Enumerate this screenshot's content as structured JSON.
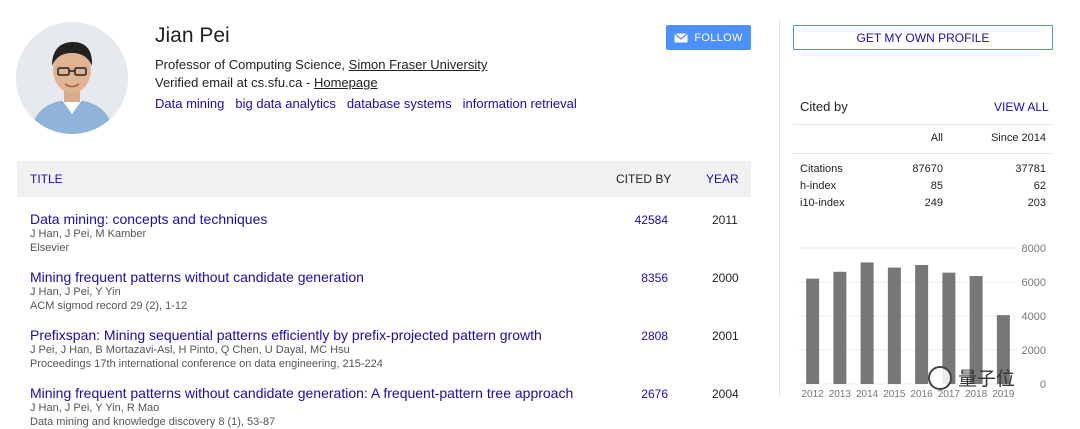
{
  "profile": {
    "name": "Jian Pei",
    "affiliation_prefix": "Professor of Computing Science, ",
    "affiliation_link": "Simon Fraser University",
    "email_text": "Verified email at cs.sfu.ca - ",
    "homepage_link": "Homepage",
    "interests": [
      "Data mining",
      "big data analytics",
      "database systems",
      "information retrieval"
    ],
    "follow_label": "FOLLOW"
  },
  "table": {
    "headers": {
      "title": "TITLE",
      "cited_by": "CITED BY",
      "year": "YEAR"
    },
    "rows": [
      {
        "title": "Data mining: concepts and techniques",
        "authors": "J Han, J Pei, M Kamber",
        "venue": "Elsevier",
        "cited_by": "42584",
        "year": "2011"
      },
      {
        "title": "Mining frequent patterns without candidate generation",
        "authors": "J Han, J Pei, Y Yin",
        "venue": "ACM sigmod record 29 (2), 1-12",
        "cited_by": "8356",
        "year": "2000"
      },
      {
        "title": "Prefixspan: Mining sequential patterns efficiently by prefix-projected pattern growth",
        "authors": "J Pei, J Han, B Mortazavi-Asl, H Pinto, Q Chen, U Dayal, MC Hsu",
        "venue": "Proceedings 17th international conference on data engineering, 215-224",
        "cited_by": "2808",
        "year": "2001"
      },
      {
        "title": "Mining frequent patterns without candidate generation: A frequent-pattern tree approach",
        "authors": "J Han, J Pei, Y Yin, R Mao",
        "venue": "Data mining and knowledge discovery 8 (1), 53-87",
        "cited_by": "2676",
        "year": "2004"
      }
    ]
  },
  "sidebar": {
    "own_profile_label": "GET MY OWN PROFILE",
    "cited_by_label": "Cited by",
    "view_all_label": "VIEW ALL",
    "stats_headers": {
      "all": "All",
      "since": "Since 2014"
    },
    "stats": [
      {
        "label": "Citations",
        "all": "87670",
        "since": "37781"
      },
      {
        "label": "h-index",
        "all": "85",
        "since": "62"
      },
      {
        "label": "i10-index",
        "all": "249",
        "since": "203"
      }
    ]
  },
  "watermark": {
    "text": "量子位"
  },
  "chart_data": {
    "type": "bar",
    "categories": [
      "2012",
      "2013",
      "2014",
      "2015",
      "2016",
      "2017",
      "2018",
      "2019"
    ],
    "values": [
      6200,
      6600,
      7150,
      6850,
      7000,
      6550,
      6350,
      4050
    ],
    "yticks": [
      0,
      2000,
      4000,
      6000,
      8000
    ],
    "ylim": [
      0,
      8000
    ],
    "bar_color": "#777777",
    "title": "",
    "xlabel": "",
    "ylabel": ""
  }
}
